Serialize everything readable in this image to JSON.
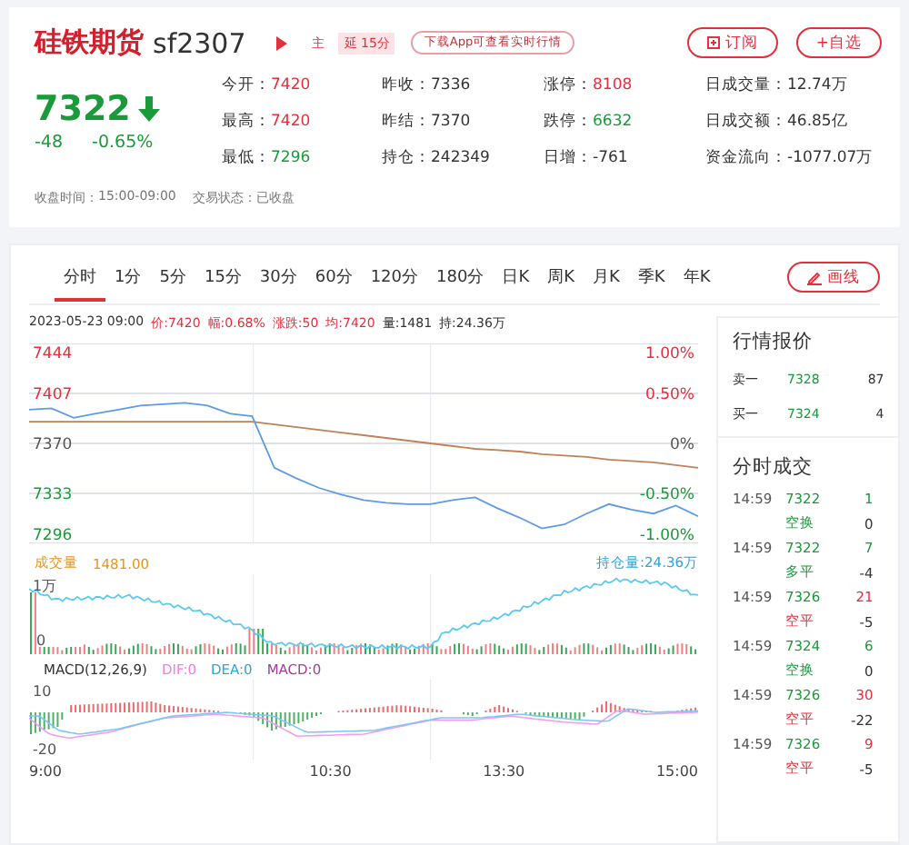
{
  "header": {
    "name": "硅铁期货",
    "code": "sf2307",
    "badges": [
      {
        "text": "主",
        "kind": "main"
      },
      {
        "text": "延 15分",
        "kind": "delay"
      }
    ],
    "app_link": "下载App可查看实时行情",
    "buttons": [
      {
        "label": "订阅",
        "kind": "subscribe"
      },
      {
        "label": "+自选",
        "kind": "add"
      }
    ]
  },
  "quote": {
    "price": "7322",
    "falling": true,
    "change": "-48",
    "change_pct": "-0.65%"
  },
  "stats": [
    {
      "label": "今开：",
      "value": "7420",
      "color": "#e62e3b"
    },
    {
      "label": "昨收：",
      "value": "7336",
      "color": "#333333"
    },
    {
      "label": "涨停：",
      "value": "8108",
      "color": "#e62e3b"
    },
    {
      "label": "日成交量：",
      "value": "12.74万",
      "color": "#333333"
    },
    {
      "label": "最高：",
      "value": "7420",
      "color": "#e62e3b"
    },
    {
      "label": "昨结：",
      "value": "7370",
      "color": "#333333"
    },
    {
      "label": "跌停：",
      "value": "6632",
      "color": "#1a9a3a"
    },
    {
      "label": "日成交额：",
      "value": "46.85亿",
      "color": "#333333"
    },
    {
      "label": "最低：",
      "value": "7296",
      "color": "#1a9a3a"
    },
    {
      "label": "持仓：",
      "value": "242349",
      "color": "#333333"
    },
    {
      "label": "日增：",
      "value": "-761",
      "color": "#333333"
    },
    {
      "label": "资金流向：",
      "value": "-1077.07万",
      "color": "#333333"
    }
  ],
  "status": [
    {
      "label": "收盘时间：",
      "value": "15:00-09:00"
    },
    {
      "label": "交易状态：",
      "value": "已收盘"
    }
  ],
  "periods": [
    {
      "label": "分时",
      "selected": true
    },
    {
      "label": "1分",
      "selected": false
    },
    {
      "label": "5分",
      "selected": false
    },
    {
      "label": "15分",
      "selected": false
    },
    {
      "label": "30分",
      "selected": false
    },
    {
      "label": "60分",
      "selected": false
    },
    {
      "label": "120分",
      "selected": false
    },
    {
      "label": "180分",
      "selected": false
    },
    {
      "label": "日K",
      "selected": false
    },
    {
      "label": "周K",
      "selected": false
    },
    {
      "label": "月K",
      "selected": false
    },
    {
      "label": "季K",
      "selected": false
    },
    {
      "label": "年K",
      "selected": false
    }
  ],
  "draw_button": "画线",
  "info_line": [
    {
      "text": "2023-05-23 09:00",
      "color": "#333333"
    },
    {
      "kind": "price",
      "text": ":7420",
      "color": "#e62e3b"
    },
    {
      "text": "幅:0.68%",
      "color": "#e62e3b"
    },
    {
      "text": "涨跌:50",
      "color": "#e62e3b"
    },
    {
      "kind": "average",
      "text": ":7420",
      "color": "#e62e3b"
    },
    {
      "text": "量:1481",
      "color": "#333333"
    },
    {
      "text": "持:24.36万",
      "color": "#333333"
    }
  ],
  "price_chart": {
    "chart_data": {
      "type": "line",
      "ylim": [
        7296,
        7444
      ],
      "yticks": [
        7296,
        7333,
        7370,
        7407,
        7444
      ],
      "grid": true,
      "series": [
        {
          "name": "价",
          "color": "#5d9be6",
          "values": [
            7395,
            7396,
            7389,
            7392,
            7395,
            7398,
            7399,
            7400,
            7398,
            7392,
            7390,
            7352,
            7344,
            7337,
            7332,
            7328,
            7326,
            7325,
            7325,
            7328,
            7330,
            7322,
            7315,
            7307,
            7310,
            7318,
            7325,
            7321,
            7318,
            7324,
            7316
          ]
        },
        {
          "name": "均",
          "color": "#c0825a",
          "values": [
            7386,
            7386,
            7386,
            7386,
            7386,
            7386,
            7386,
            7386,
            7386,
            7386,
            7386,
            7384,
            7382,
            7380,
            7378,
            7376,
            7374,
            7372,
            7370,
            7368,
            7366,
            7365,
            7364,
            7362,
            7361,
            7360,
            7358,
            7357,
            7356,
            7354,
            7352
          ]
        }
      ]
    },
    "percent_axis": [
      {
        "text": "1.00%",
        "color": "#e62e3b"
      },
      {
        "text": "0.50%",
        "color": "#e62e3b"
      },
      {
        "text": "0%",
        "color": "#555555"
      },
      {
        "text": "-0.50%",
        "color": "#1a9a3a"
      },
      {
        "text": "-1.00%",
        "color": "#1a9a3a"
      }
    ]
  },
  "volume": {
    "label": "成交量",
    "value": "1481.00",
    "open_interest": "持仓量:24.36万",
    "axis": [
      "1万",
      "0"
    ]
  },
  "macd": {
    "title": "MACD(12,26,9)",
    "dif": "DIF:0",
    "dea": "DEA:0",
    "macd": "MACD:0",
    "axis": [
      "10",
      "-20"
    ]
  },
  "time_axis": [
    "9:00",
    "10:30",
    "13:30",
    "15:00"
  ],
  "order_book": {
    "title": "行情报价",
    "rows": [
      {
        "label": "卖一",
        "price": "7328",
        "volume": "87"
      },
      {
        "label": "买一",
        "price": "7324",
        "volume": "4"
      }
    ]
  },
  "trades": {
    "title": "分时成交",
    "rows": [
      {
        "time": "14:59",
        "price": "7322",
        "volume": "1",
        "type": "空换",
        "color": "#1a9a3a",
        "change": "0"
      },
      {
        "time": "14:59",
        "price": "7322",
        "volume": "7",
        "type": "多平",
        "color": "#1a9a3a",
        "change": "-4"
      },
      {
        "time": "14:59",
        "price": "7326",
        "volume": "21",
        "type": "空平",
        "color": "#e62e3b",
        "change": "-5"
      },
      {
        "time": "14:59",
        "price": "7324",
        "volume": "6",
        "type": "空换",
        "color": "#1a9a3a",
        "change": "0"
      },
      {
        "time": "14:59",
        "price": "7326",
        "volume": "30",
        "type": "空平",
        "color": "#e62e3b",
        "change": "-22"
      },
      {
        "time": "14:59",
        "price": "7326",
        "volume": "9",
        "type": "空平",
        "color": "#e62e3b",
        "change": "-5"
      }
    ]
  }
}
